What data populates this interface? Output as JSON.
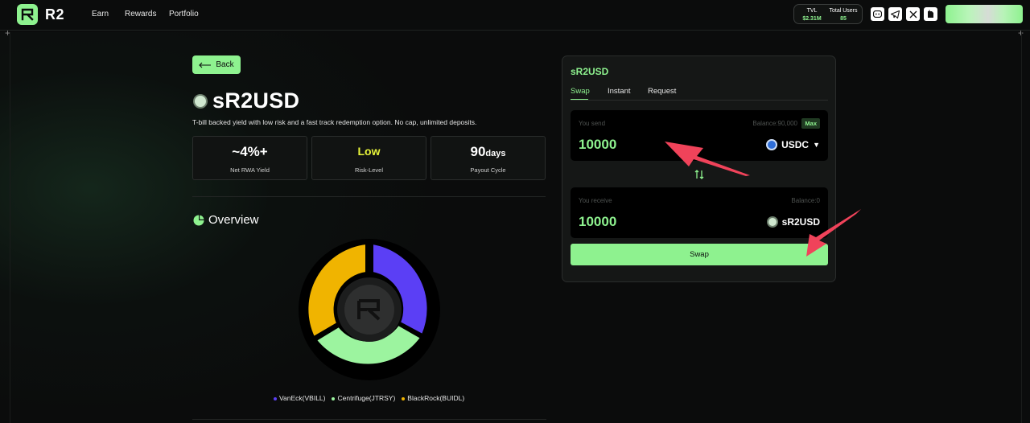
{
  "header": {
    "brand": "R2",
    "nav": [
      "Earn",
      "Rewards",
      "Portfolio"
    ],
    "stats": {
      "tvl_label": "TVL",
      "tvl_value": "$2.31M",
      "users_label": "Total Users",
      "users_value": "85"
    },
    "social_icons": [
      "discord-icon",
      "telegram-icon",
      "x-icon",
      "docs-icon"
    ]
  },
  "left": {
    "back_label": "Back",
    "token_name": "sR2USD",
    "description": "T-bill backed yield with low risk and a fast track redemption option. No cap, unlimited deposits.",
    "cards": [
      {
        "value": "~4%+",
        "label": "Net RWA Yield",
        "value_color": "#ffffff"
      },
      {
        "value": "Low",
        "label": "Risk-Level",
        "value_color": "#e8f53a"
      },
      {
        "value": "90",
        "unit": "days",
        "label": "Payout Cycle",
        "value_color": "#ffffff"
      }
    ],
    "overview_title": "Overview",
    "legend": [
      {
        "name": "VanEck(VBILL)",
        "color": "#5b3ff5"
      },
      {
        "name": "Centrifuge(JTRSY)",
        "color": "#9cf49f"
      },
      {
        "name": "BlackRock(BUIDL)",
        "color": "#f0b400"
      }
    ]
  },
  "swap_panel": {
    "title": "sR2USD",
    "tabs": [
      "Swap",
      "Instant",
      "Request"
    ],
    "active_tab": "Swap",
    "send": {
      "label": "You send",
      "balance": "Balance:90,000",
      "max_label": "Max",
      "amount": "10000",
      "asset": "USDC"
    },
    "receive": {
      "label": "You receive",
      "balance": "Balance:0",
      "amount": "10000",
      "asset": "sR2USD"
    },
    "swap_label": "Swap"
  },
  "colors": {
    "accent": "#8ef28f",
    "background": "#0b0c0c",
    "annotation_arrow": "#f0435a"
  }
}
